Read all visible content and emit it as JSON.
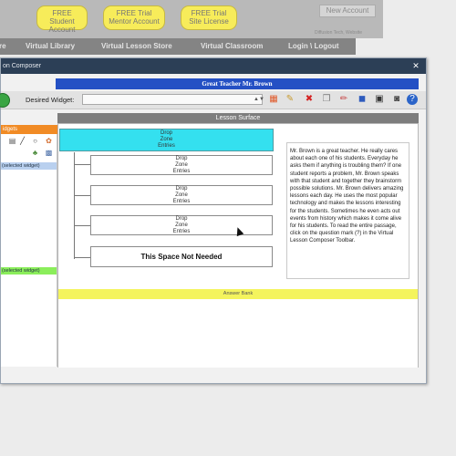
{
  "site": {
    "promos": [
      {
        "line1": "FREE",
        "line2": "Student Account"
      },
      {
        "line1": "FREE Trial",
        "line2": "Mentor Account"
      },
      {
        "line1": "FREE Trial",
        "line2": "Site License"
      }
    ],
    "account_button": "New Account",
    "tiny_link": "Diffusion Tech, Website",
    "nav": [
      {
        "label": "re"
      },
      {
        "label": "Virtual Library"
      },
      {
        "label": "Virtual Lesson Store"
      },
      {
        "label": "Virtual Classroom"
      },
      {
        "label": "Login \\ Logout"
      }
    ]
  },
  "window": {
    "title": "on Composer",
    "close_glyph": "✕"
  },
  "teacher_title": "Great Teacher Mr. Brown",
  "toolbar": {
    "widget_label": "Desired Widget:",
    "widget_value": "",
    "icons": [
      {
        "name": "palette-icon",
        "glyph": "▦",
        "color": "#e05a2b"
      },
      {
        "name": "hammer-icon",
        "glyph": "✎",
        "color": "#c89b2e"
      },
      {
        "name": "delete-icon",
        "glyph": "✖",
        "color": "#d42222"
      },
      {
        "name": "copy-icon",
        "glyph": "❐",
        "color": "#7b7b7b"
      },
      {
        "name": "pencil-icon",
        "glyph": "✏",
        "color": "#c84a4a"
      },
      {
        "name": "layers-icon",
        "glyph": "◼",
        "color": "#2e5bbd"
      },
      {
        "name": "preview-icon",
        "glyph": "▣",
        "color": "#333"
      },
      {
        "name": "camera-icon",
        "glyph": "◙",
        "color": "#444"
      },
      {
        "name": "help-icon",
        "glyph": "?",
        "color": "#ffffff"
      }
    ]
  },
  "palette": {
    "header": "idgets",
    "selected_widget_blue": "(selected widget)",
    "selected_widget_green": "(selected widget)"
  },
  "lesson": {
    "header": "Lesson Surface",
    "drop_zone_lines": [
      "Drop",
      "Zone",
      "Entries"
    ],
    "drop_zone_count": 3,
    "last_zone_label": "This Space Not Needed",
    "story": "Mr. Brown is a great teacher. He really cares about each one of his students. Everyday he asks them if anything is troubling them? If one student reports a problem, Mr. Brown speaks with that student and together they brainstorm possible solutions. Mr. Brown delivers amazing lessons each day. He uses the most popular technology and makes the lessons interesting for the students. Sometimes he even acts out events from history which makes it come alive for his students. To read the entire passage, click on the question mark (?) in the Virtual Lesson Composer Toolbar.",
    "answer_bank": "Answer Bank"
  },
  "colors": {
    "title_bar": "#2c3f56",
    "teacher_bar": "#2450c4",
    "drop_zone_top": "#34e0ef",
    "palette_header": "#f18b25",
    "answer_bank": "#f4f45d"
  }
}
